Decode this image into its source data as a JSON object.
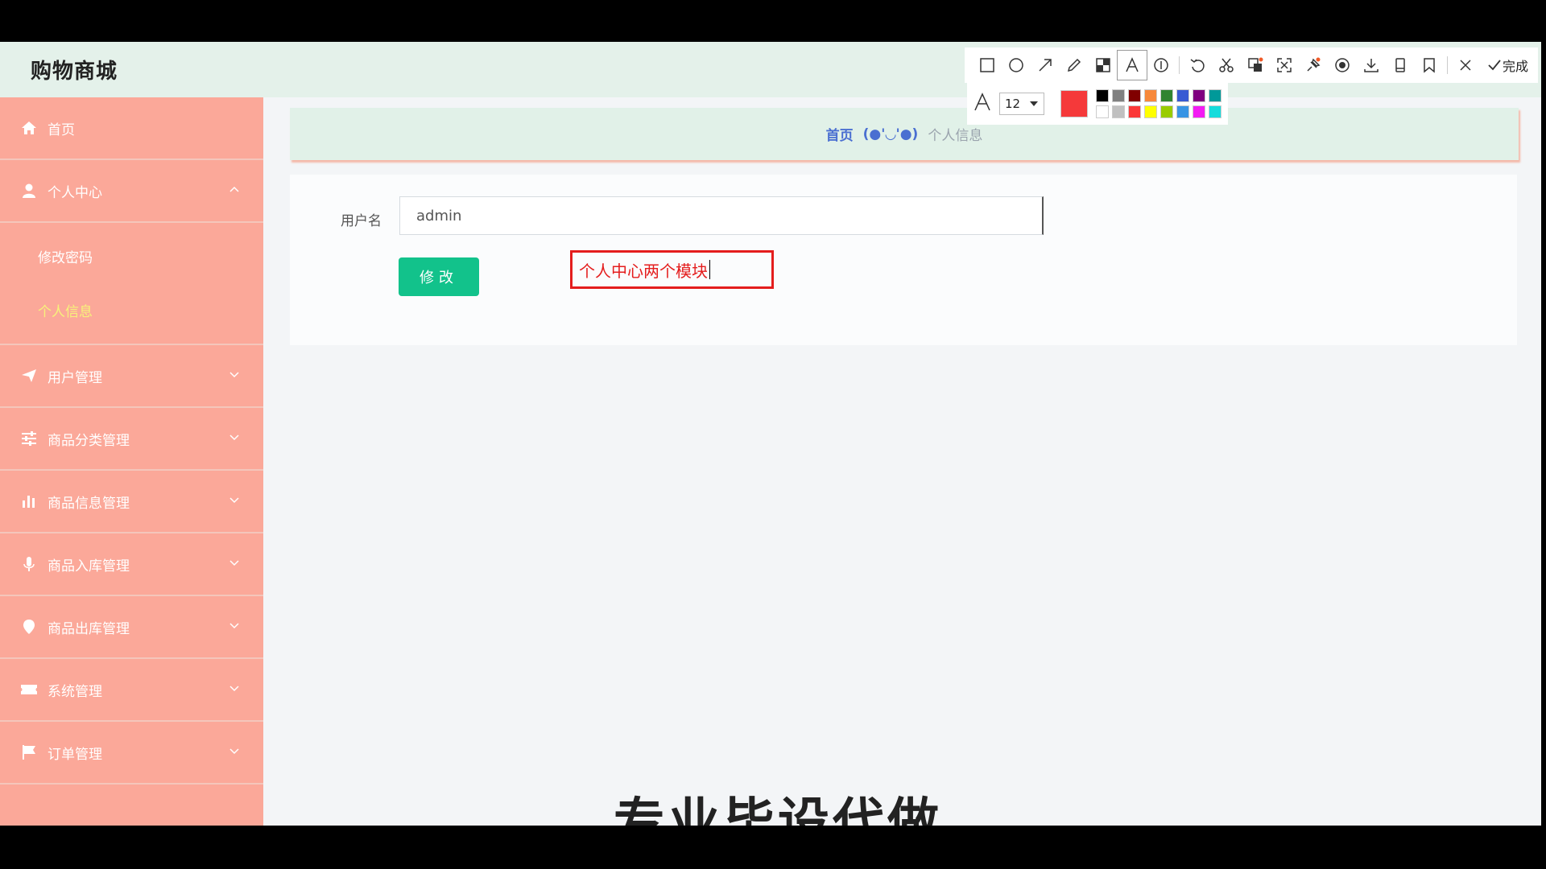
{
  "brand": {
    "title": "购物商城"
  },
  "sidebar": {
    "items": [
      {
        "label": "首页",
        "icon": "home-icon"
      },
      {
        "label": "个人中心",
        "icon": "user-icon",
        "expanded": true,
        "children": [
          {
            "label": "修改密码",
            "active": false
          },
          {
            "label": "个人信息",
            "active": true
          }
        ]
      },
      {
        "label": "用户管理",
        "icon": "paper-plane-icon"
      },
      {
        "label": "商品分类管理",
        "icon": "sliders-icon"
      },
      {
        "label": "商品信息管理",
        "icon": "bar-chart-icon"
      },
      {
        "label": "商品入库管理",
        "icon": "microphone-icon"
      },
      {
        "label": "商品出库管理",
        "icon": "location-pin-icon"
      },
      {
        "label": "系统管理",
        "icon": "ticket-icon"
      },
      {
        "label": "订单管理",
        "icon": "flag-icon"
      }
    ]
  },
  "breadcrumb": {
    "home": "首页",
    "separator": "(●'◡'●)",
    "current": "个人信息"
  },
  "form": {
    "username_label": "用户名",
    "username_value": "admin",
    "submit_label": "修改"
  },
  "annotation": {
    "text": "个人中心两个模块",
    "color": "#e41d1d"
  },
  "watermark": {
    "text": "专业毕设代做"
  },
  "screenshot_tool": {
    "done_label": "完成",
    "font_size": "12",
    "current_color": "#f5393a",
    "palette": [
      "#000000",
      "#808080",
      "#800000",
      "#f7883a",
      "#308430",
      "#385ad3",
      "#800080",
      "#009999",
      "#ffffff",
      "#c0c0c0",
      "#fb3838",
      "#ffff00",
      "#99cc00",
      "#3894e4",
      "#f31bf3",
      "#16dcdc"
    ]
  },
  "colors": {
    "sidebar_bg": "#fba899",
    "header_bg": "#e4f1ea",
    "accent": "#12c28b",
    "active_submenu": "#f7f27a"
  }
}
